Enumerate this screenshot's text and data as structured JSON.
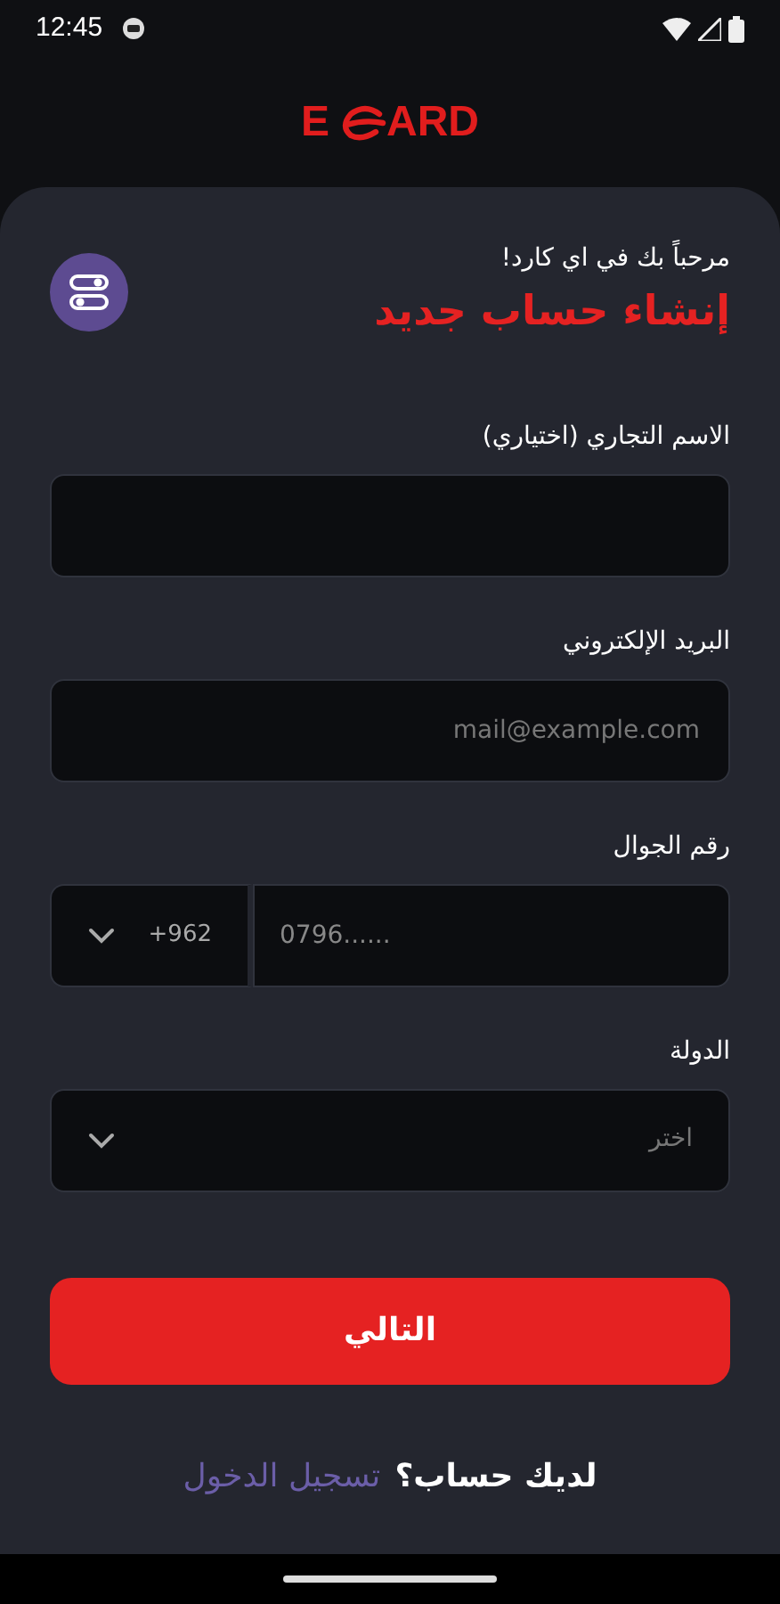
{
  "status_bar": {
    "time": "12:45"
  },
  "logo": {
    "left": "E",
    "right": "ARD"
  },
  "header": {
    "welcome": "مرحباً بك في اي كارد!",
    "title": "إنشاء حساب جديد"
  },
  "fields": [
    {
      "kind": "text",
      "label": "الاسم التجاري (اختياري)"
    },
    {
      "kind": "text",
      "label": "البريد الإلكتروني",
      "placeholder": "mail@example.com"
    },
    {
      "kind": "phone",
      "label": "رقم الجوال",
      "code": "+962",
      "placeholder": "0796......"
    },
    {
      "kind": "select",
      "label": "الدولة",
      "placeholder": "اختر"
    }
  ],
  "next_button": "التالي",
  "footer": {
    "question": "لديك حساب؟",
    "link": "تسجيل الدخول"
  }
}
